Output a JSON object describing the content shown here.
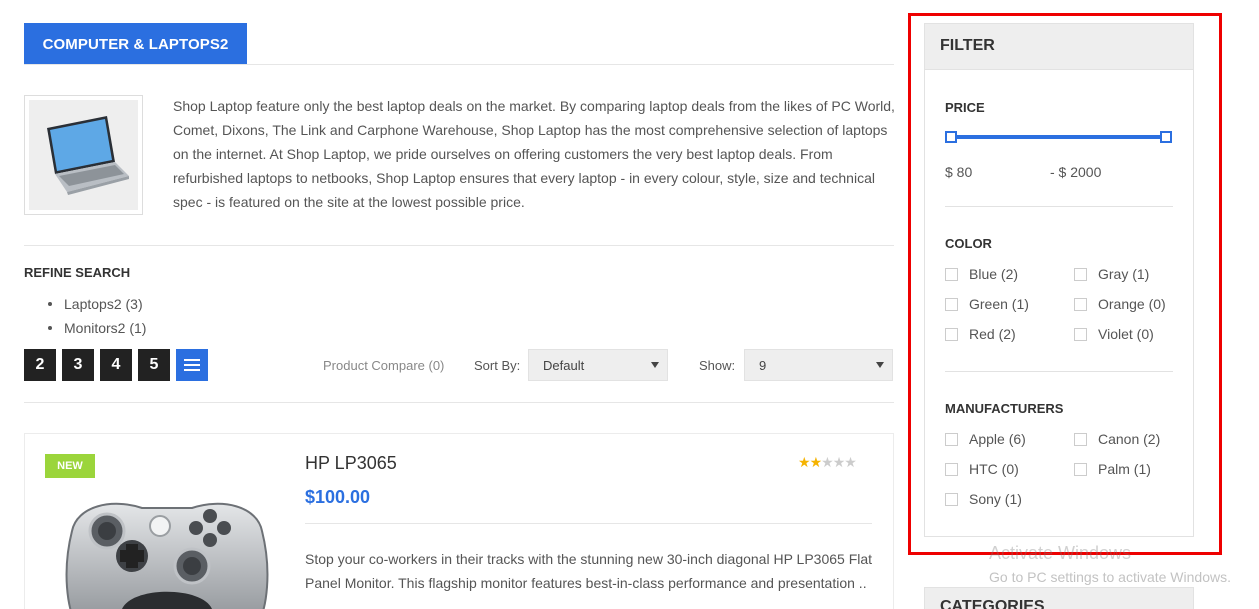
{
  "category": {
    "title": "COMPUTER & LAPTOPS2",
    "description": "Shop Laptop feature only the best laptop deals on the market. By comparing laptop deals from the likes of PC World, Comet, Dixons, The Link and Carphone Warehouse, Shop Laptop has the most comprehensive selection of laptops on the internet. At Shop Laptop, we pride ourselves on offering customers the very best laptop deals. From refurbished laptops to netbooks, Shop Laptop ensures that every laptop - in every colour, style, size and technical spec - is featured on the site at the lowest possible price."
  },
  "refine": {
    "title": "REFINE SEARCH",
    "items": [
      "Laptops2 (3)",
      "Monitors2 (1)"
    ]
  },
  "toolbar": {
    "pages": [
      "2",
      "3",
      "4",
      "5"
    ],
    "compare": "Product Compare (0)",
    "sort_label": "Sort By:",
    "sort_value": "Default",
    "show_label": "Show:",
    "show_value": "9"
  },
  "product": {
    "badge": "NEW",
    "name": "HP LP3065",
    "price": "$100.00",
    "rating": 2,
    "rating_max": 5,
    "description": "Stop your co-workers in their tracks with the stunning new 30-inch diagonal HP LP3065 Flat Panel Monitor. This flagship monitor features best-in-class performance and presentation .."
  },
  "filter": {
    "title": "FILTER",
    "price": {
      "title": "PRICE",
      "min": "$ 80",
      "max": "- $ 2000",
      "range_low": 0,
      "range_high": 1
    },
    "color": {
      "title": "COLOR",
      "options": [
        "Blue (2)",
        "Gray (1)",
        "Green (1)",
        "Orange (0)",
        "Red (2)",
        "Violet (0)"
      ]
    },
    "manufacturers": {
      "title": "MANUFACTURERS",
      "options": [
        "Apple (6)",
        "Canon (2)",
        "HTC (0)",
        "Palm (1)",
        "Sony (1)"
      ]
    }
  },
  "categories": {
    "title": "CATEGORIES"
  },
  "watermark": {
    "line1": "Activate Windows",
    "line2": "Go to PC settings to activate Windows."
  },
  "colors": {
    "accent": "#2b6fe0",
    "badge": "#9bd53b",
    "star": "#f5b301",
    "highlight_frame": "#e00000"
  }
}
